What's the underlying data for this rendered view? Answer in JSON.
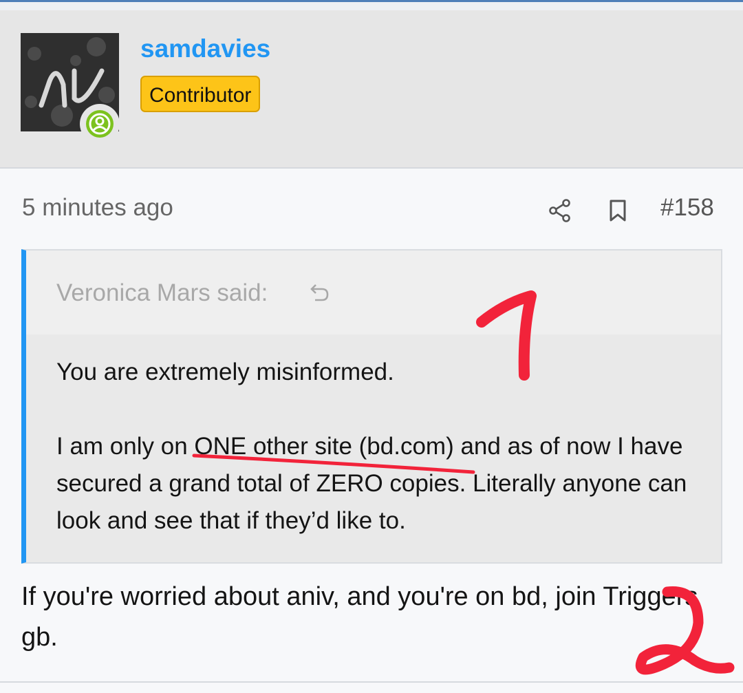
{
  "user": {
    "name": "samdavies",
    "role": "Contributor"
  },
  "post": {
    "timestamp": "5 minutes ago",
    "number": "#158",
    "share_icon": "share-icon",
    "bookmark_icon": "bookmark-icon"
  },
  "quote": {
    "author": "Veronica Mars said:",
    "jump_icon": "undo-arrow-icon",
    "line1": "You are extremely misinformed.",
    "line2": "I am only on ONE other site (bd.com) and as of now I have secured a grand total of ZERO copies. Literally anyone can look and see that if they’d like to."
  },
  "reply": {
    "text": "If you're worried about aniv, and you're on bd, join Triggers gb."
  },
  "annotations": {
    "color": "#f2233a",
    "marks": [
      "1",
      "2"
    ]
  },
  "colors": {
    "username": "#2196f3",
    "badge": "#fdc418",
    "quote_border": "#2196f3",
    "online": "#7cc21e"
  }
}
